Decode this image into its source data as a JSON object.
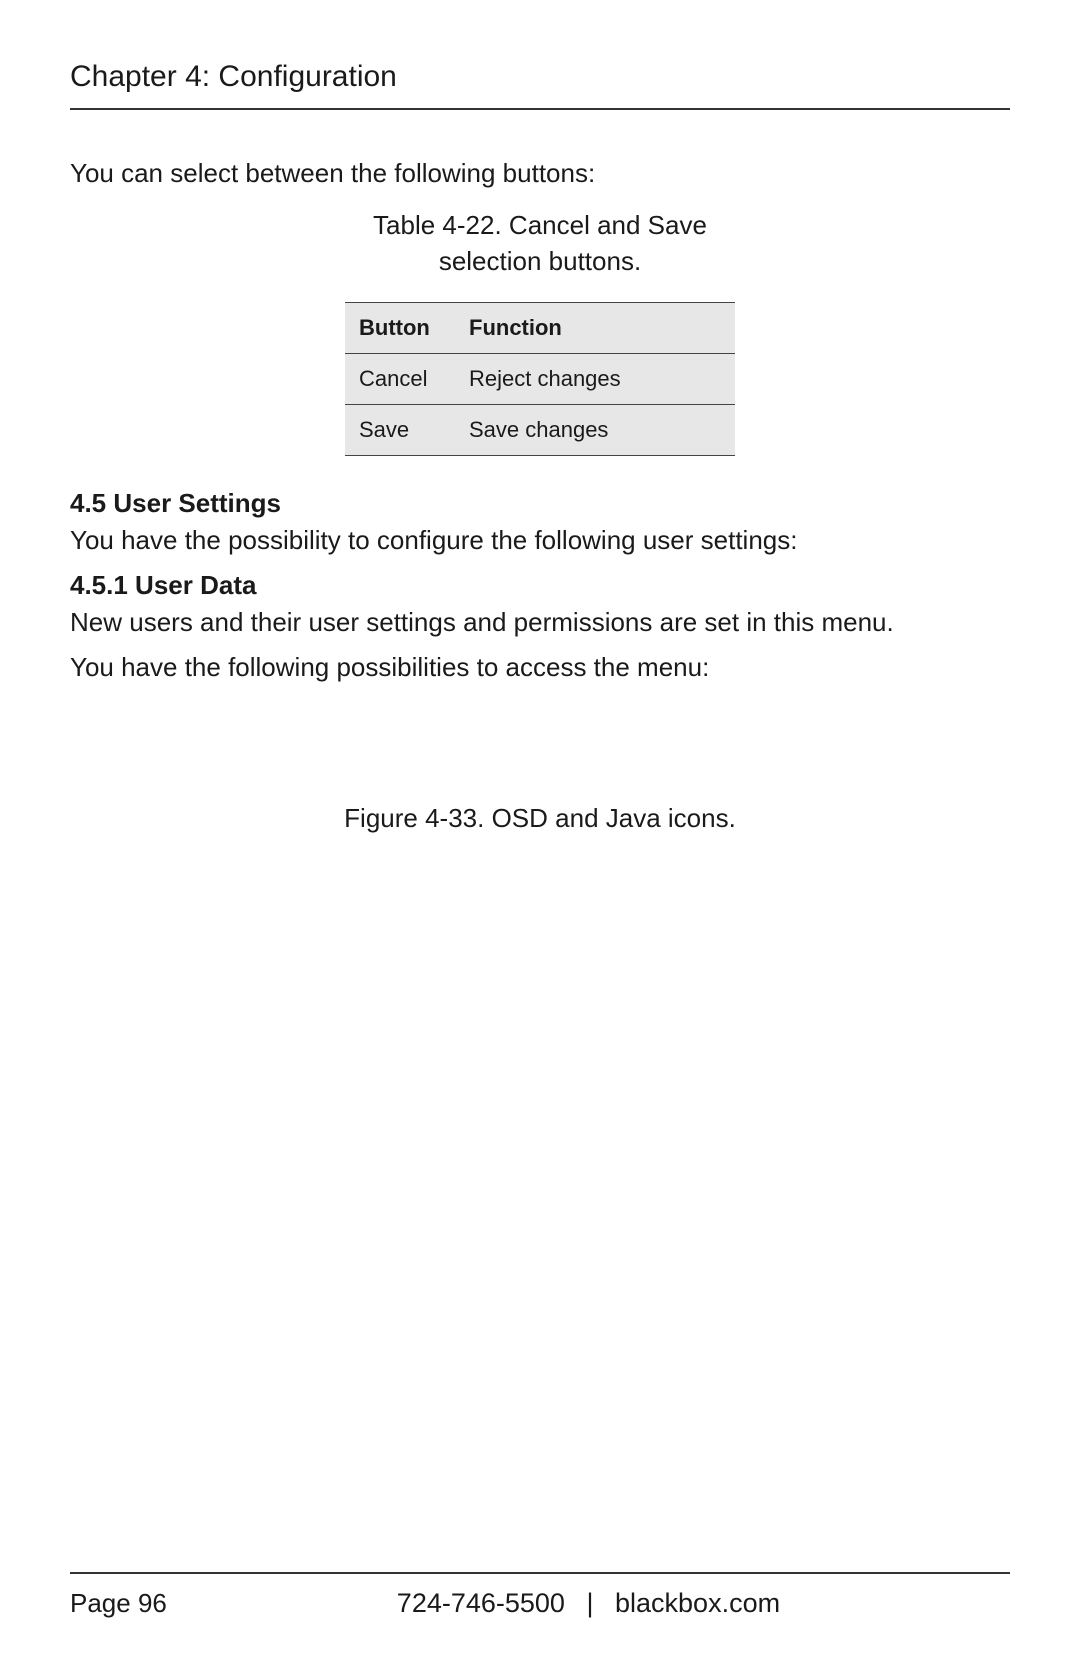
{
  "header": {
    "chapter_title": "Chapter 4: Configuration"
  },
  "intro": "You can select between the following buttons:",
  "table_caption_line1": "Table 4-22. Cancel and Save",
  "table_caption_line2": "selection buttons.",
  "table": {
    "headers": {
      "col1": "Button",
      "col2": "Function"
    },
    "rows": [
      {
        "button": "Cancel",
        "function": "Reject changes"
      },
      {
        "button": "Save",
        "function": "Save changes"
      }
    ]
  },
  "sections": {
    "s45_heading": "4.5 User Settings",
    "s45_body": "You have the possibility to configure the following user settings:",
    "s451_heading": "4.5.1 User Data",
    "s451_body1": "New users and their user settings and permissions are set in this menu.",
    "s451_body2": "You have the following possibilities to access the menu:"
  },
  "figure_caption": "Figure 4-33. OSD and Java icons.",
  "footer": {
    "page": "Page 96",
    "phone": "724-746-5500",
    "divider": "|",
    "site": "blackbox.com"
  }
}
